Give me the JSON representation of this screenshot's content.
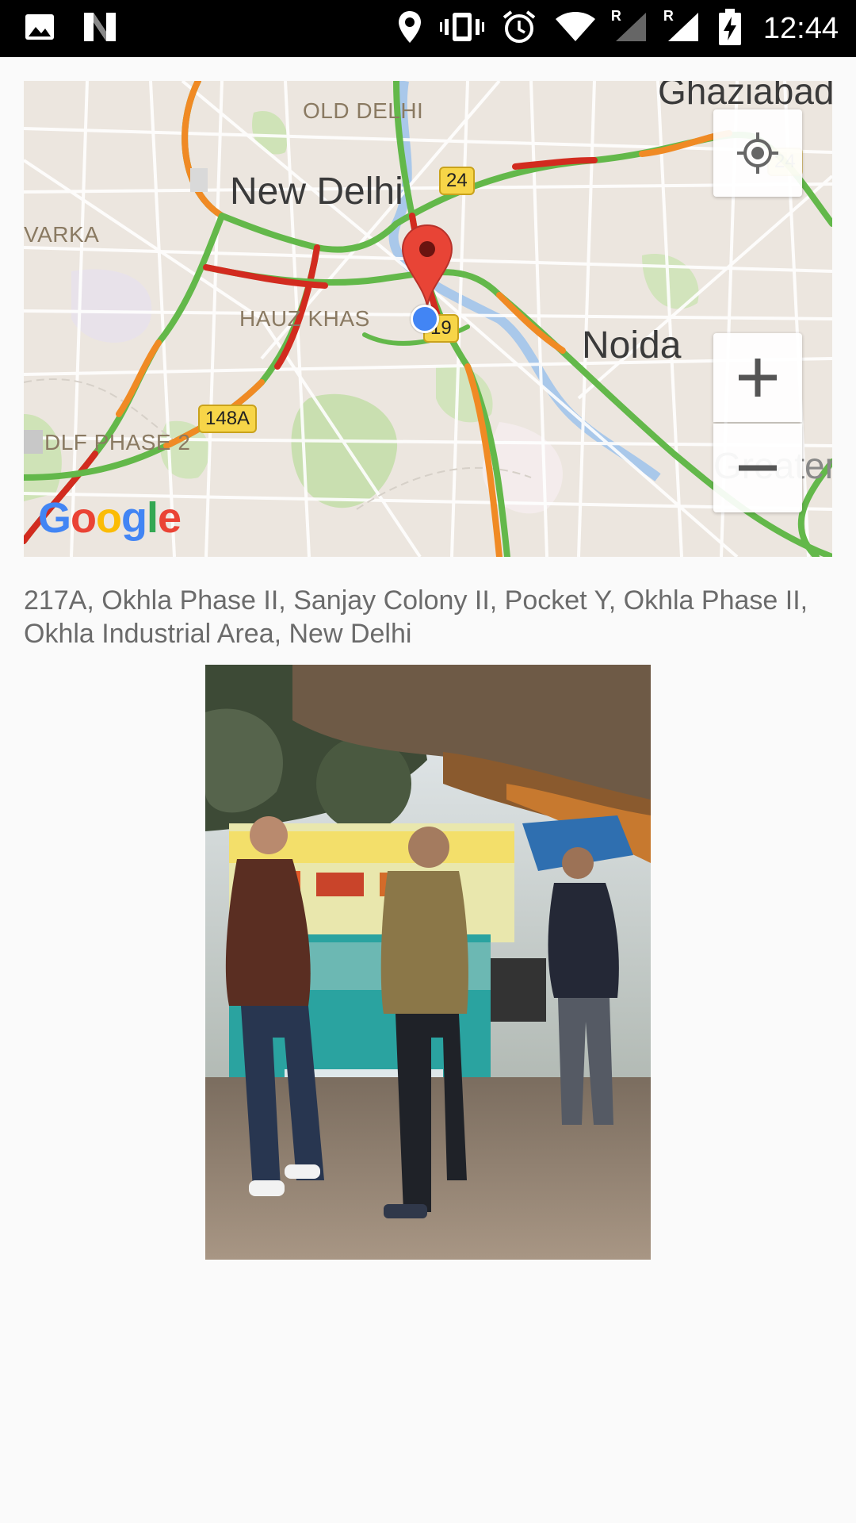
{
  "status_bar": {
    "time": "12:44",
    "left_icons": [
      "gallery-icon",
      "n-logo-icon"
    ],
    "right_icons": [
      "location-icon",
      "vibrate-icon",
      "alarm-icon",
      "wifi-icon",
      "signal-r-icon",
      "signal-r-icon",
      "battery-charging-icon"
    ],
    "roaming_marker": "R"
  },
  "map": {
    "labels": {
      "ghaziabad": "Ghaziabad",
      "old_delhi": "OLD DELHI",
      "new_delhi": "New Delhi",
      "dwarka": "VARKA",
      "hauz_khas": "HAUZ KHAS",
      "noida": "Noida",
      "dlf": "DLF PHASE 2",
      "greater": "Greater"
    },
    "shields": {
      "r24": "24",
      "r19": "19",
      "r148a": "148A",
      "r24b": "24"
    },
    "logo": "Google",
    "controls": {
      "zoom_in": "+",
      "zoom_out": "−"
    },
    "colors": {
      "land": "#ece6df",
      "traffic_green": "#63b84a",
      "traffic_orange": "#f08a24",
      "traffic_red": "#d22b1f",
      "marker_red": "#e84436",
      "my_location": "#4285f4"
    }
  },
  "address": "217A, Okhla Phase II, Sanjay Colony II, Pocket Y, Okhla Phase II, Okhla Industrial Area, New Delhi"
}
